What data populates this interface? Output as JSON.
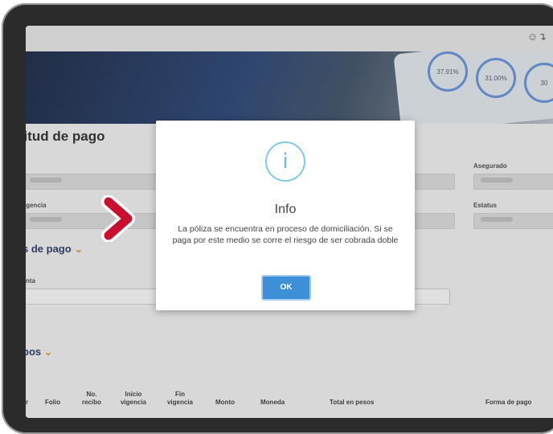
{
  "page": {
    "title_fragment": "citud de pago",
    "labels": {
      "asegurado": "Asegurado",
      "vigencia_fragment": "igencia",
      "estatus": "Estatus",
      "cuenta_fragment": "nta"
    },
    "sections": {
      "pago_fragment": "s de pago",
      "recibos_fragment": "bos"
    },
    "table_headers": [
      "r",
      "Folio",
      "No. recibo",
      "Inicio vigencia",
      "Fin vigencia",
      "Monto",
      "Moneda",
      "Total en pesos",
      "Forma de pago"
    ]
  },
  "banner_stats": [
    "37.91%",
    "31.00%",
    "30"
  ],
  "modal": {
    "icon": "info-icon",
    "title": "Info",
    "message": "La póliza se encuentra en proceso de domiciliación. Si se paga por este medio se corre el riesgo de ser cobrada doble",
    "ok_label": "OK"
  },
  "colors": {
    "accent": "#3d8fd8",
    "info_icon": "#7fc9ec",
    "arrow": "#c8102e",
    "chevron": "#e08a1e"
  }
}
